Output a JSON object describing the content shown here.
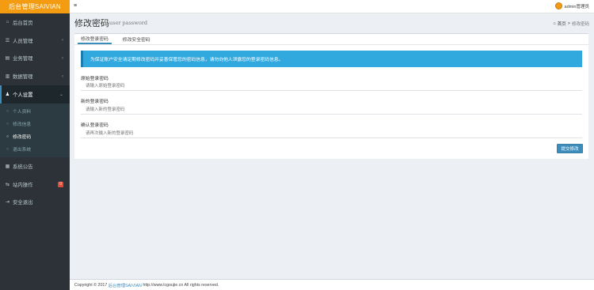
{
  "header": {
    "logo": "后台管理SAIVIAN",
    "toggle_icon": "≡",
    "user_name": "admin管理员"
  },
  "sidebar": {
    "items": [
      {
        "label": "后台首页",
        "icon": "home-icon",
        "glyph": "⌂",
        "chevron": ""
      },
      {
        "label": "人员管理",
        "icon": "users-icon",
        "glyph": "☰",
        "chevron": "‹"
      },
      {
        "label": "业务管理",
        "icon": "layers-icon",
        "glyph": "▤",
        "chevron": "‹"
      },
      {
        "label": "数据管理",
        "icon": "chart-icon",
        "glyph": "▥",
        "chevron": "‹"
      },
      {
        "label": "个人设置",
        "icon": "user-icon",
        "glyph": "♟",
        "chevron": "⌄"
      }
    ],
    "submenu": [
      {
        "label": "个人资料",
        "glyph": "○"
      },
      {
        "label": "修改信息",
        "glyph": "○"
      },
      {
        "label": "修改密码",
        "glyph": "○"
      },
      {
        "label": "退出系统",
        "glyph": "○"
      }
    ],
    "bottom_items": [
      {
        "label": "系统公告",
        "icon": "notice-icon",
        "glyph": "▦",
        "badge": ""
      },
      {
        "label": "站内操作",
        "icon": "exchange-icon",
        "glyph": "⇆",
        "badge": "0"
      },
      {
        "label": "安全退出",
        "icon": "logout-icon",
        "glyph": "⇥",
        "badge": ""
      }
    ]
  },
  "page": {
    "title": "修改密码",
    "subtitle": "user password",
    "breadcrumb_home": "首页",
    "breadcrumb_sep": ">",
    "breadcrumb_current": "修改密码"
  },
  "tabs": [
    {
      "label": "修改登录密码"
    },
    {
      "label": "修改安全密码"
    }
  ],
  "notice": "为保证账户安全请定期修改密码并妥善保管您的密码信息，请勿向他人泄露您的登录密码信息。",
  "form": {
    "fields": [
      {
        "label": "原始登录密码",
        "placeholder": "请输入原始登录密码"
      },
      {
        "label": "新的登录密码",
        "placeholder": "请输入新的登录密码"
      },
      {
        "label": "确认登录密码",
        "placeholder": "请再次输入新的登录密码"
      }
    ],
    "submit_label": "提交修改"
  },
  "footer": {
    "prefix": "Copyright © 2017",
    "link": "后台管理SAIVIAN",
    "suffix": "http://www.lcgoujie.cn All rights reserved."
  },
  "colors": {
    "logo_bg": "#f39c12",
    "sidebar_bg": "#2c3237",
    "accent": "#3c8dbc",
    "callout_bg": "#31a8de",
    "badge": "#dd4b39"
  }
}
